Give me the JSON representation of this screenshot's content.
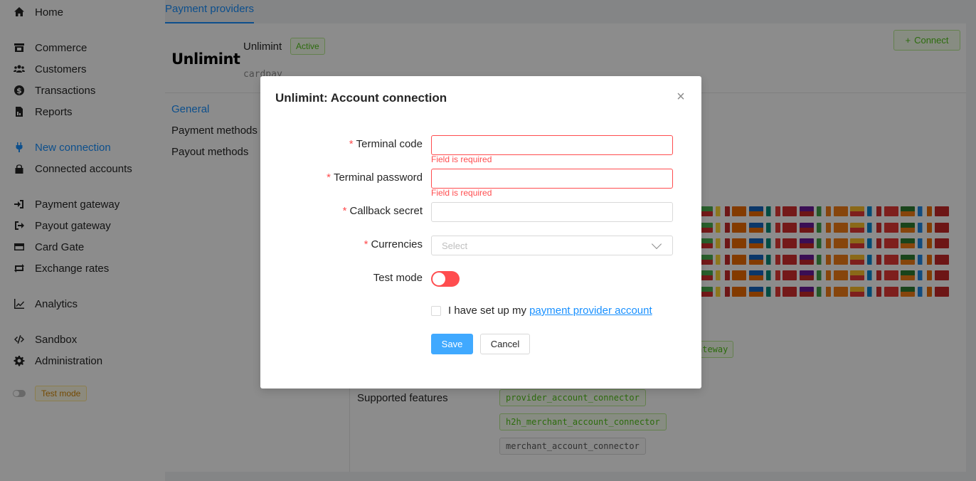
{
  "sidebar": {
    "items": [
      {
        "label": "Home",
        "icon": "home-icon"
      },
      {
        "label": "Commerce",
        "icon": "store-icon"
      },
      {
        "label": "Customers",
        "icon": "users-icon"
      },
      {
        "label": "Transactions",
        "icon": "dollar-icon"
      },
      {
        "label": "Reports",
        "icon": "report-icon"
      },
      {
        "label": "New connection",
        "icon": "plug-icon",
        "active": true
      },
      {
        "label": "Connected accounts",
        "icon": "lock-icon"
      },
      {
        "label": "Payment gateway",
        "icon": "login-icon"
      },
      {
        "label": "Payout gateway",
        "icon": "logout-icon"
      },
      {
        "label": "Card Gate",
        "icon": "card-icon"
      },
      {
        "label": "Exchange rates",
        "icon": "exchange-icon"
      },
      {
        "label": "Analytics",
        "icon": "chart-icon"
      },
      {
        "label": "Sandbox",
        "icon": "code-icon"
      },
      {
        "label": "Administration",
        "icon": "gear-icon"
      }
    ],
    "test_mode_label": "Test mode"
  },
  "header": {
    "tab_label": "Payment providers"
  },
  "provider": {
    "logo_text": "Unlimint",
    "name": "Unlimint",
    "status": "Active",
    "subtitle": "cardpay",
    "connect_label": "Connect"
  },
  "side_tabs": [
    "General",
    "Payment methods",
    "Payout methods"
  ],
  "details": {
    "gateway_tag": "ateway",
    "supported_features_label": "Supported features",
    "features": [
      "provider_account_connector",
      "h2h_merchant_account_connector",
      "merchant_account_connector"
    ]
  },
  "flag_colors": [
    "#4caf50",
    "#1e88e5",
    "#e53935",
    "#fbc02d",
    "#43a047",
    "#d32f2f",
    "#1565c0",
    "#fdd835",
    "#c62828",
    "#2e7d32",
    "#0288d1",
    "#f57f17",
    "#6a1b9a",
    "#00897b",
    "#ef6c00"
  ],
  "modal": {
    "title": "Unlimint: Account connection",
    "close_icon": "close-icon",
    "terminal_code_label": "Terminal code",
    "terminal_code_value": "",
    "terminal_code_error": "Field is required",
    "terminal_password_label": "Terminal password",
    "terminal_password_value": "",
    "terminal_password_error": "Field is required",
    "callback_secret_label": "Callback secret",
    "callback_secret_value": "",
    "currencies_label": "Currencies",
    "currencies_placeholder": "Select",
    "test_mode_label": "Test mode",
    "checkbox_text": "I have set up my",
    "checkbox_link": "payment provider account",
    "save_label": "Save",
    "cancel_label": "Cancel"
  },
  "colors": {
    "accent": "#1890ff",
    "error": "#ff4d4f",
    "success": "#52c41a"
  }
}
